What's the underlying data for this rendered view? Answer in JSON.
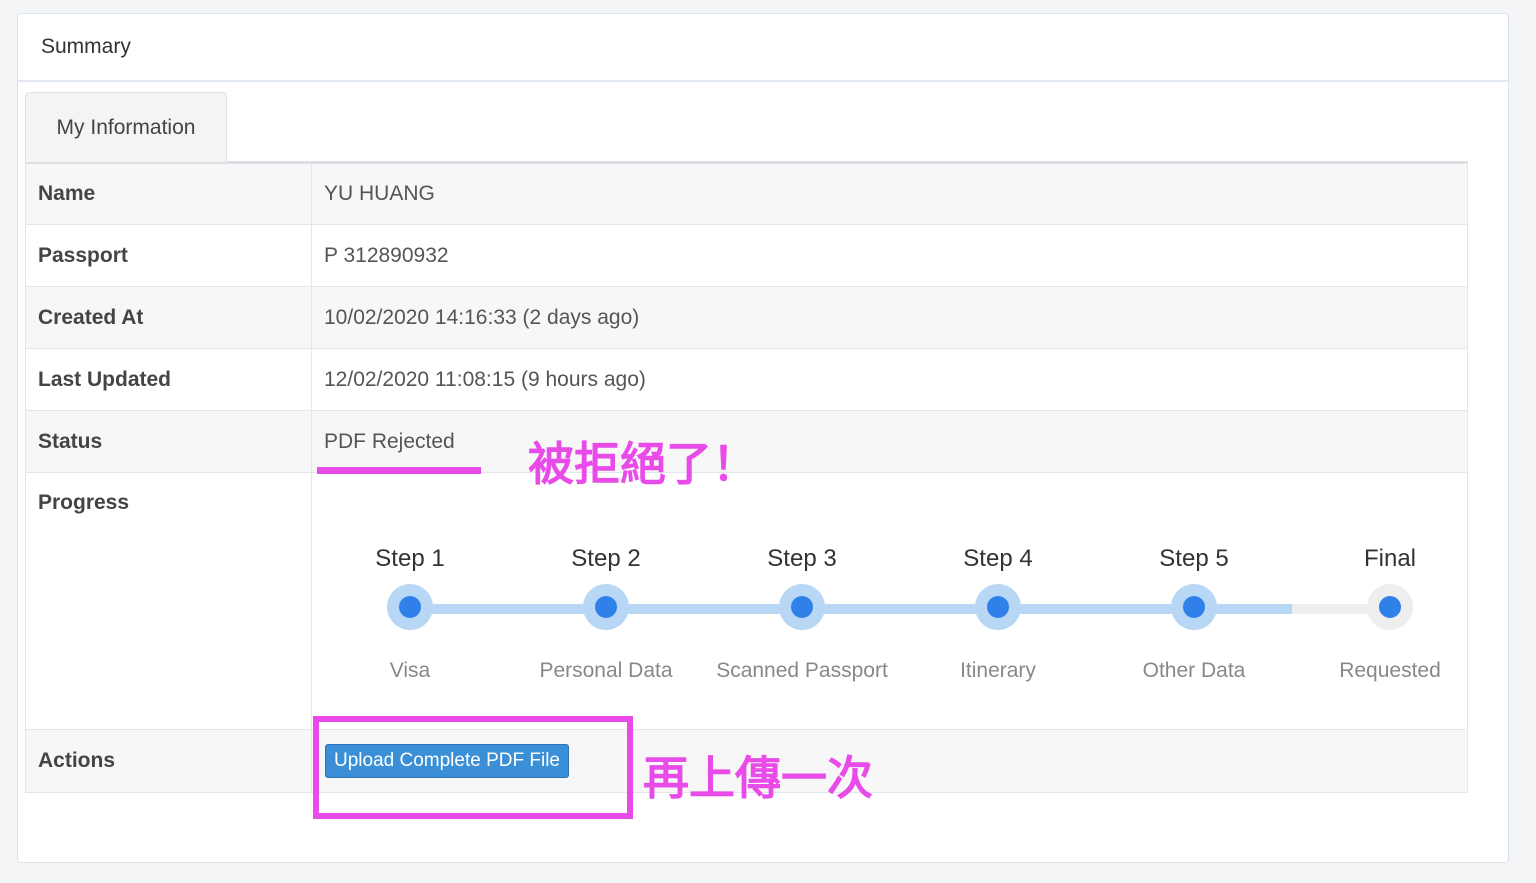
{
  "panel": {
    "title": "Summary"
  },
  "tab": {
    "label": "My Information"
  },
  "rows": {
    "name": {
      "label": "Name",
      "value": "YU HUANG"
    },
    "passport": {
      "label": "Passport",
      "value": "P 312890932"
    },
    "created": {
      "label": "Created At",
      "value": "10/02/2020 14:16:33 (2 days ago)"
    },
    "updated": {
      "label": "Last Updated",
      "value": "12/02/2020 11:08:15 (9 hours ago)"
    },
    "status": {
      "label": "Status",
      "value": "PDF Rejected"
    },
    "progress": {
      "label": "Progress"
    },
    "actions": {
      "label": "Actions",
      "button": "Upload Complete PDF File"
    }
  },
  "steps": [
    {
      "title": "Step 1",
      "label": "Visa",
      "state": "active"
    },
    {
      "title": "Step 2",
      "label": "Personal Data",
      "state": "active"
    },
    {
      "title": "Step 3",
      "label": "Scanned Passport",
      "state": "active"
    },
    {
      "title": "Step 4",
      "label": "Itinerary",
      "state": "active"
    },
    {
      "title": "Step 5",
      "label": "Other Data",
      "state": "active"
    },
    {
      "title": "Final",
      "label": "Requested",
      "state": "pending"
    }
  ],
  "annotations": {
    "status_note": "被拒絕了！",
    "action_note": "再上傳一次"
  },
  "colors": {
    "annotation": "#e84be8",
    "step_active": "#2f80e8",
    "step_track": "#b7d7f5",
    "step_track_inactive": "#eeeeee",
    "button": "#3b8fd6"
  }
}
